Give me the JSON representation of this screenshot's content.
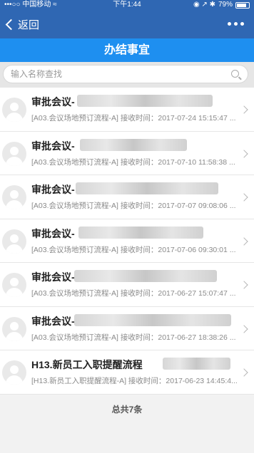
{
  "status": {
    "carrier": "•••○○ 中国移动",
    "wifi": "≈",
    "time": "下午1:44",
    "icons": "◉ ↗ ✱",
    "battery": "79%",
    "battery_level": 0.79
  },
  "nav": {
    "back_label": "返回"
  },
  "header": {
    "title": "办结事宜"
  },
  "search": {
    "placeholder": "输入名称查找"
  },
  "items": [
    {
      "title": "审批会议-",
      "sub": "[A03.会议场地预订流程-A] 接收时间：2017-07-24 15:15:47 ..."
    },
    {
      "title": "审批会议-",
      "sub": "[A03.会议场地预订流程-A] 接收时间：2017-07-10 11:58:38 ..."
    },
    {
      "title": "审批会议-",
      "sub": "[A03.会议场地预订流程-A] 接收时间：2017-07-07 09:08:06 ..."
    },
    {
      "title": "审批会议-",
      "sub": "[A03.会议场地预订流程-A] 接收时间：2017-07-06 09:30:01 ..."
    },
    {
      "title": "审批会议-",
      "sub": "[A03.会议场地预订流程-A] 接收时间：2017-06-27 15:07:47 ..."
    },
    {
      "title": "审批会议-",
      "sub": "[A03.会议场地预订流程-A] 接收时间：2017-06-27 18:38:26 ..."
    },
    {
      "title": "H13.新员工入职提醒流程",
      "sub": "[H13.新员工入职提醒流程-A] 接收时间：2017-06-23 14:45:4..."
    }
  ],
  "footer": {
    "total": "总共7条"
  }
}
